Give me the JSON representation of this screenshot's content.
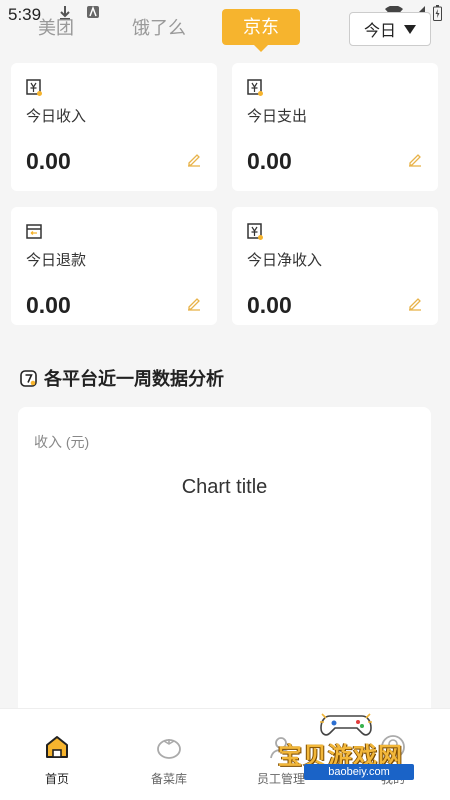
{
  "status_bar": {
    "time": "5:39"
  },
  "tabs": [
    {
      "label": "美团"
    },
    {
      "label": "饿了么"
    },
    {
      "label": "京东",
      "active": true
    }
  ],
  "period": {
    "selected": "今日"
  },
  "cards": [
    {
      "label": "今日收入",
      "value": "0.00",
      "icon": "yuan-icon"
    },
    {
      "label": "今日支出",
      "value": "0.00",
      "icon": "yuan-icon"
    },
    {
      "label": "今日退款",
      "value": "0.00",
      "icon": "refund-icon"
    },
    {
      "label": "今日净收入",
      "value": "0.00",
      "icon": "yuan-icon"
    }
  ],
  "section": {
    "title": "各平台近一周数据分析"
  },
  "chart": {
    "y_label": "收入 (元)",
    "title": "Chart title"
  },
  "bottom_nav": [
    {
      "label": "首页",
      "icon": "home-icon",
      "active": true
    },
    {
      "label": "备菜库",
      "icon": "tomato-icon"
    },
    {
      "label": "员工管理",
      "icon": "staff-icon"
    },
    {
      "label": "我的",
      "icon": "user-icon"
    }
  ],
  "watermark": {
    "text": "宝贝游戏网",
    "url": "baobeiy.com"
  },
  "colors": {
    "accent": "#f6b42e",
    "background": "#f5f5f5",
    "card": "#ffffff"
  }
}
